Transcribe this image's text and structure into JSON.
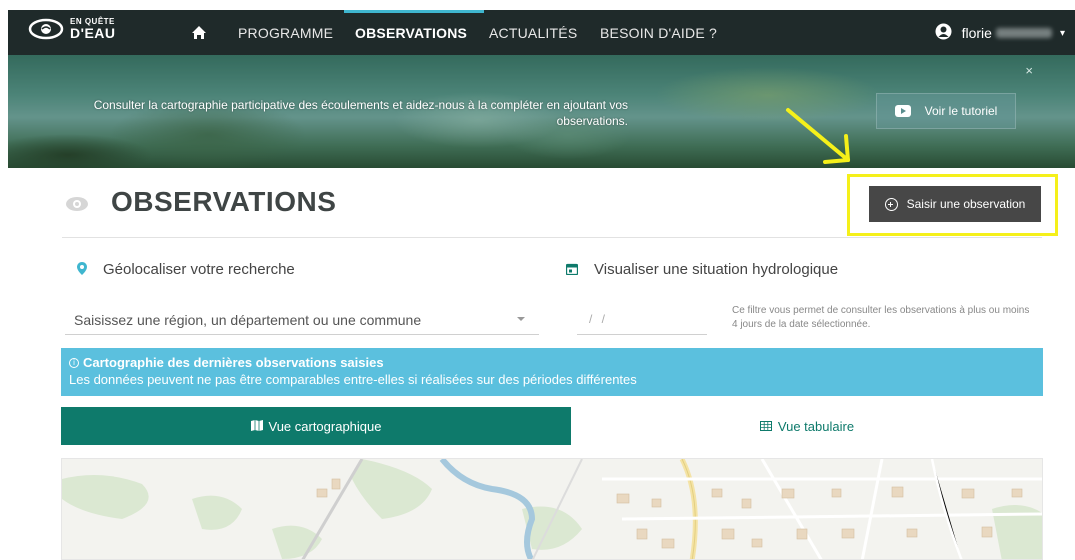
{
  "nav": {
    "logo_line1": "EN QUÊTE",
    "logo_line2": "D'EAU",
    "items": [
      {
        "label": "PROGRAMME",
        "active": false
      },
      {
        "label": "OBSERVATIONS",
        "active": true
      },
      {
        "label": "ACTUALITÉS",
        "active": false
      },
      {
        "label": "BESOIN D'AIDE ?",
        "active": false
      }
    ],
    "user_name": "florie"
  },
  "banner": {
    "text": "Consulter la cartographie participative des écoulements et aidez-nous à la compléter en ajoutant vos observations.",
    "close": "×",
    "tutorial_button": "Voir le tutoriel"
  },
  "header": {
    "title": "OBSERVATIONS",
    "add_button": "Saisir une observation"
  },
  "filters": {
    "geo_label": "Géolocaliser votre recherche",
    "hydro_label": "Visualiser une situation hydrologique",
    "region_placeholder": "Saisissez une région, un département ou une commune",
    "date_placeholder": "/ /",
    "date_help": "Ce filtre vous permet de consulter les observations à plus ou moins 4 jours de la date sélectionnée."
  },
  "info": {
    "title": "Cartographie des dernières observations saisies",
    "text": "Les données peuvent ne pas être comparables entre-elles si réalisées sur des périodes différentes"
  },
  "tabs": [
    {
      "label": "Vue cartographique",
      "active": true
    },
    {
      "label": "Vue tabulaire",
      "active": false
    }
  ],
  "colors": {
    "nav_bg": "#1f2a2a",
    "accent": "#0e7a6b",
    "info_bg": "#5bc0de",
    "highlight": "#f5f01a",
    "button_dark": "#474747"
  }
}
